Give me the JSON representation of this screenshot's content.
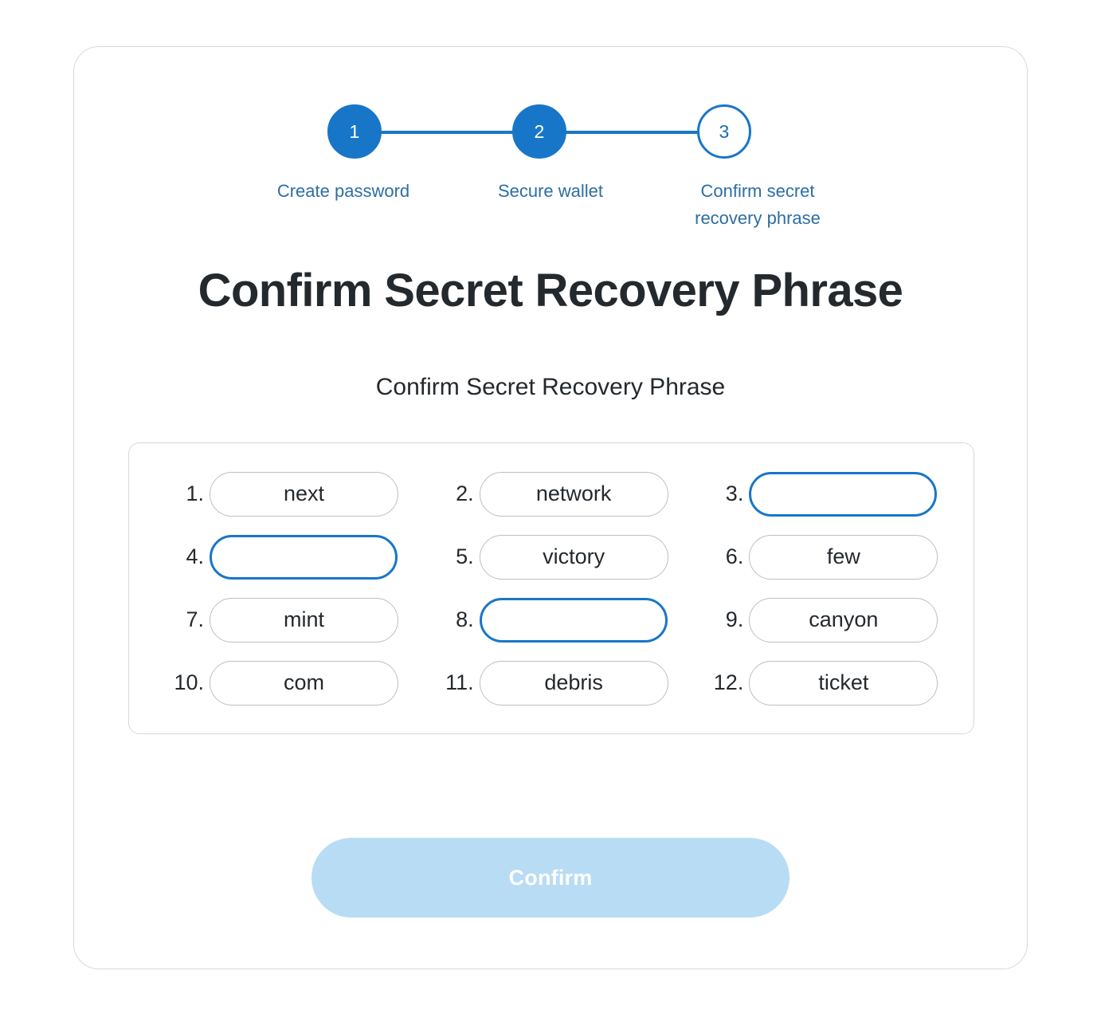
{
  "colors": {
    "accent": "#1876c8",
    "step_label": "#2c6ea3",
    "text": "#24292e",
    "card_border": "#d6d9dc",
    "pill_border": "#bbc0c5",
    "button_disabled_bg": "#b8dcf4",
    "button_text": "#ffffff",
    "background": "#ffffff"
  },
  "stepper": {
    "steps": [
      {
        "number": "1",
        "label_line1": "Create password",
        "label_line2": "",
        "state": "done"
      },
      {
        "number": "2",
        "label_line1": "Secure wallet",
        "label_line2": "",
        "state": "done"
      },
      {
        "number": "3",
        "label_line1": "Confirm secret",
        "label_line2": "recovery phrase",
        "state": "current"
      }
    ]
  },
  "header": {
    "title": "Confirm Secret Recovery Phrase",
    "subtitle": "Confirm Secret Recovery Phrase"
  },
  "phrase": {
    "words": [
      {
        "index": "1.",
        "value": "next",
        "state": "filled"
      },
      {
        "index": "2.",
        "value": "network",
        "state": "filled"
      },
      {
        "index": "3.",
        "value": "",
        "state": "blank"
      },
      {
        "index": "4.",
        "value": "",
        "state": "blank"
      },
      {
        "index": "5.",
        "value": "victory",
        "state": "filled"
      },
      {
        "index": "6.",
        "value": "few",
        "state": "filled"
      },
      {
        "index": "7.",
        "value": "mint",
        "state": "filled"
      },
      {
        "index": "8.",
        "value": "",
        "state": "blank"
      },
      {
        "index": "9.",
        "value": "canyon",
        "state": "filled"
      },
      {
        "index": "10.",
        "value": "com",
        "state": "filled"
      },
      {
        "index": "11.",
        "value": "debris",
        "state": "filled"
      },
      {
        "index": "12.",
        "value": "ticket",
        "state": "filled"
      }
    ]
  },
  "footer": {
    "confirm_label": "Confirm"
  }
}
